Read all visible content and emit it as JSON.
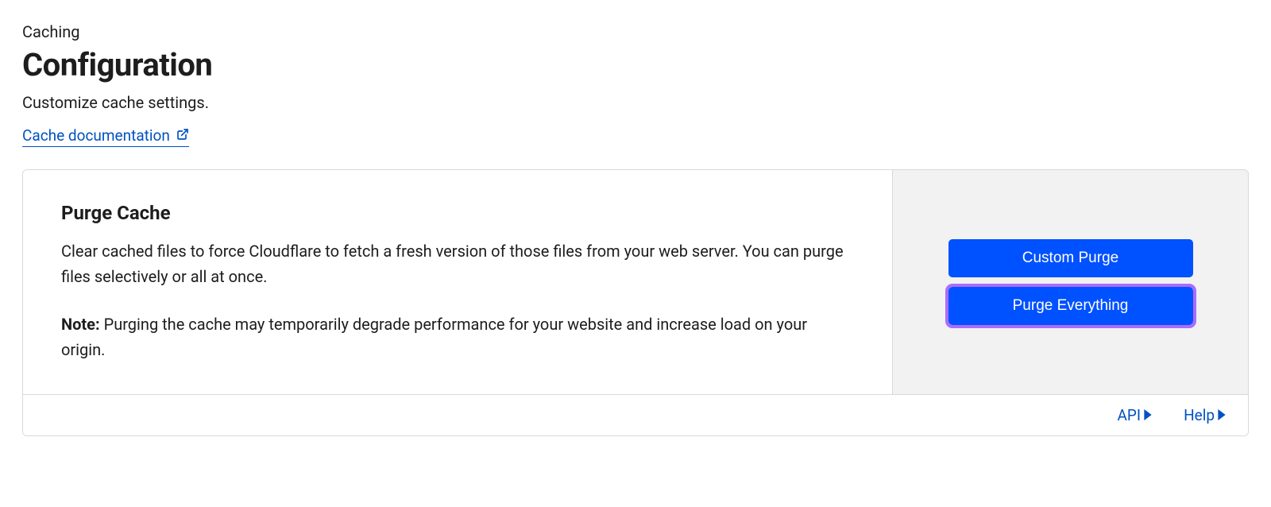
{
  "header": {
    "breadcrumb": "Caching",
    "title": "Configuration",
    "subtitle": "Customize cache settings.",
    "doc_link_label": "Cache documentation"
  },
  "card": {
    "title": "Purge Cache",
    "description": "Clear cached files to force Cloudflare to fetch a fresh version of those files from your web server. You can purge files selectively or all at once.",
    "note_label": "Note:",
    "note_text": " Purging the cache may temporarily degrade performance for your website and increase load on your origin.",
    "buttons": {
      "custom_purge": "Custom Purge",
      "purge_everything": "Purge Everything"
    },
    "footer": {
      "api": "API",
      "help": "Help"
    }
  }
}
